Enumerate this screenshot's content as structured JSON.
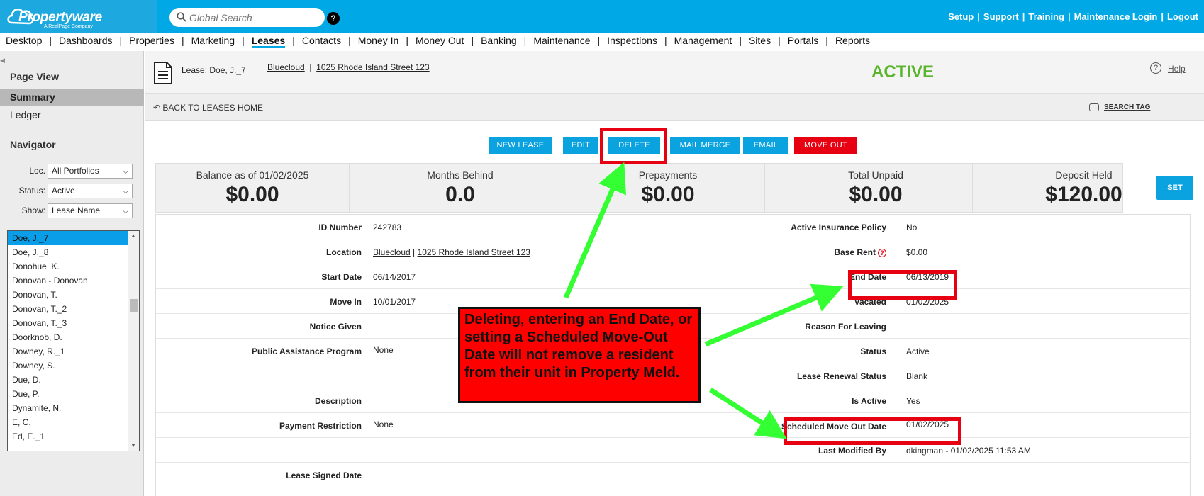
{
  "topbar": {
    "logo_text": "Propertyware",
    "logo_sub": "A RealPage Company",
    "search_placeholder": "Global Search",
    "help_glyph": "?",
    "links": [
      "Setup",
      "Support",
      "Training",
      "Maintenance Login",
      "Logout"
    ]
  },
  "mainnav": {
    "items": [
      "Desktop",
      "Dashboards",
      "Properties",
      "Marketing",
      "Leases",
      "Contacts",
      "Money In",
      "Money Out",
      "Banking",
      "Maintenance",
      "Inspections",
      "Management",
      "Sites",
      "Portals",
      "Reports"
    ],
    "active": "Leases"
  },
  "sidebar": {
    "page_view_heading": "Page View",
    "page_view_items": [
      "Summary",
      "Ledger"
    ],
    "navigator_heading": "Navigator",
    "loc_label": "Loc.",
    "loc_value": "All Portfolios",
    "status_label": "Status:",
    "status_value": "Active",
    "show_label": "Show:",
    "show_value": "Lease Name",
    "lease_list": [
      "Doe, J._7",
      "Doe, J._8",
      "Donohue, K.",
      "Donovan - Donovan",
      "Donovan, T.",
      "Donovan, T._2",
      "Donovan, T._3",
      "Doorknob, D.",
      "Downey, R._1",
      "Downey, S.",
      "Due, D.",
      "Due, P.",
      "Dynamite, N.",
      "E, C.",
      "Ed, E._1"
    ]
  },
  "lease": {
    "title": "Lease: Doe, J._7",
    "portfolio": "Bluecloud",
    "address": "1025 Rhode Island Street  123",
    "status": "ACTIVE",
    "help": "Help",
    "back_link": "BACK TO LEASES HOME",
    "search_tag": "SEARCH TAG"
  },
  "buttons": {
    "new_lease": "NEW LEASE",
    "edit": "EDIT",
    "delete": "DELETE",
    "mail_merge": "MAIL MERGE",
    "email": "EMAIL",
    "move_out": "MOVE OUT",
    "set": "SET"
  },
  "stats": [
    {
      "label": "Balance as of 01/02/2025",
      "value": "$0.00"
    },
    {
      "label": "Months Behind",
      "value": "0.0"
    },
    {
      "label": "Prepayments",
      "value": "$0.00"
    },
    {
      "label": "Total Unpaid",
      "value": "$0.00"
    },
    {
      "label": "Deposit Held",
      "value": "$120.00"
    }
  ],
  "details_left": [
    {
      "label": "ID Number",
      "value": "242783"
    },
    {
      "label": "Location",
      "value": "Bluecloud | 1025 Rhode Island Street  123"
    },
    {
      "label": "Start Date",
      "value": "06/14/2017"
    },
    {
      "label": "Move In",
      "value": "10/01/2017"
    },
    {
      "label": "Notice Given",
      "value": ""
    },
    {
      "label": "Public Assistance Program",
      "value": "None"
    },
    {
      "label": "",
      "value": ""
    },
    {
      "label": "Description",
      "value": ""
    },
    {
      "label": "Payment Restriction",
      "value": "None"
    },
    {
      "label": "",
      "value": ""
    },
    {
      "label": "Lease Signed Date",
      "value": ""
    }
  ],
  "location_link_portfolio": "Bluecloud",
  "location_link_address": "1025 Rhode Island Street  123",
  "details_right": [
    {
      "label": "Active Insurance Policy",
      "value": "No"
    },
    {
      "label": "Base Rent",
      "value": "$0.00"
    },
    {
      "label": "End Date",
      "value": "06/13/2019"
    },
    {
      "label": "Vacated",
      "value": "01/02/2025"
    },
    {
      "label": "Reason For Leaving",
      "value": ""
    },
    {
      "label": "Status",
      "value": "Active"
    },
    {
      "label": "Lease Renewal Status",
      "value": "Blank"
    },
    {
      "label": "Is Active",
      "value": "Yes"
    },
    {
      "label": "Scheduled Move Out Date",
      "value": "01/02/2025"
    },
    {
      "label": "Last Modified By",
      "value": "dkingman - 01/02/2025 11:53 AM"
    }
  ],
  "annotation": {
    "callout_text": "Deleting, entering an End Date, or setting a Scheduled Move-Out Date will not remove a resident from their unit in Property Meld.",
    "arrow_color": "#33ff33",
    "box_color": "#e60012"
  },
  "colors": {
    "brand_blue": "#00a9e6",
    "active_green": "#5ab52c",
    "move_out_red": "#e60012"
  }
}
